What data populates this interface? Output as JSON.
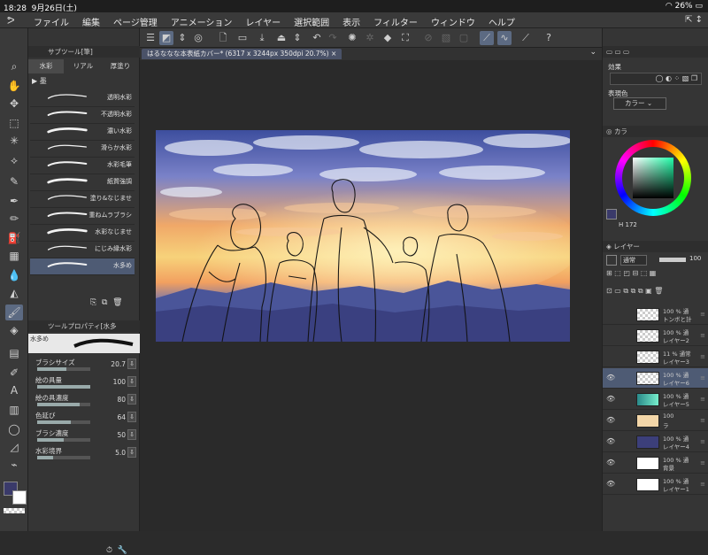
{
  "status": {
    "time": "18:28",
    "date": "9月26日(土)",
    "battery": "26%"
  },
  "menu": [
    "ファイル",
    "編集",
    "ページ管理",
    "アニメーション",
    "レイヤー",
    "選択範囲",
    "表示",
    "フィルター",
    "ウィンドウ",
    "ヘルプ"
  ],
  "doc_tab": "はるななな本表紙カバー* (6317 x 3244px 350dpi 20.7%)",
  "subtool": {
    "header": "サブツール[筆]",
    "tabs": [
      "水彩",
      "リアル",
      "厚塗り"
    ],
    "group": "墨",
    "brushes": [
      "透明水彩",
      "不透明水彩",
      "濃い水彩",
      "滑らか水彩",
      "水彩毛筆",
      "紙質強調",
      "塗り&なじませ",
      "重ねムラブラシ",
      "水彩なじませ",
      "にじみ縁水彩",
      "水多め"
    ],
    "selected_brush": "水多め"
  },
  "tool_property": {
    "header": "ツールプロパティ[水多",
    "preview_name": "水多め",
    "props": [
      {
        "label": "ブラシサイズ",
        "value": "20.7",
        "fill": 0.55
      },
      {
        "label": "絵の具量",
        "value": "100",
        "fill": 1.0
      },
      {
        "label": "絵の具濃度",
        "value": "80",
        "fill": 0.8
      },
      {
        "label": "色延び",
        "value": "64",
        "fill": 0.64
      },
      {
        "label": "ブラシ濃度",
        "value": "50",
        "fill": 0.5
      },
      {
        "label": "水彩境界",
        "value": "5.0",
        "fill": 0.3
      }
    ]
  },
  "right": {
    "effect_label": "効果",
    "color_expr_label": "表現色",
    "color_mode": "カラー",
    "colorwheel_header": "カラ",
    "color_values": "172",
    "layer_header": "レイヤー",
    "blend_mode": "通常",
    "opacity": "100",
    "layers": [
      {
        "op": "100 % 通",
        "name": "トンボと計",
        "thumb": "checker",
        "visible": false
      },
      {
        "op": "100 % 通",
        "name": "レイヤー2",
        "thumb": "checker",
        "visible": false
      },
      {
        "op": "11 % 通常",
        "name": "レイヤー3",
        "thumb": "sketch",
        "visible": false
      },
      {
        "op": "100 % 通",
        "name": "レイヤー6",
        "thumb": "sketch",
        "visible": true,
        "selected": true
      },
      {
        "op": "100 % 通",
        "name": "レイヤー5",
        "thumb": "teal",
        "visible": true
      },
      {
        "op": "100",
        "name": "ラ",
        "thumb": "folder",
        "visible": true
      },
      {
        "op": "100 % 通",
        "name": "レイヤー4",
        "thumb": "navy",
        "visible": true
      },
      {
        "op": "100 % 通",
        "name": "背景",
        "thumb": "white",
        "visible": true
      },
      {
        "op": "100 % 通",
        "name": "レイヤー1",
        "thumb": "white",
        "visible": true
      }
    ]
  },
  "colors": {
    "accent": "#5c6a82",
    "main_color": "#3a3a6a",
    "sub_color": "#ffffff"
  }
}
